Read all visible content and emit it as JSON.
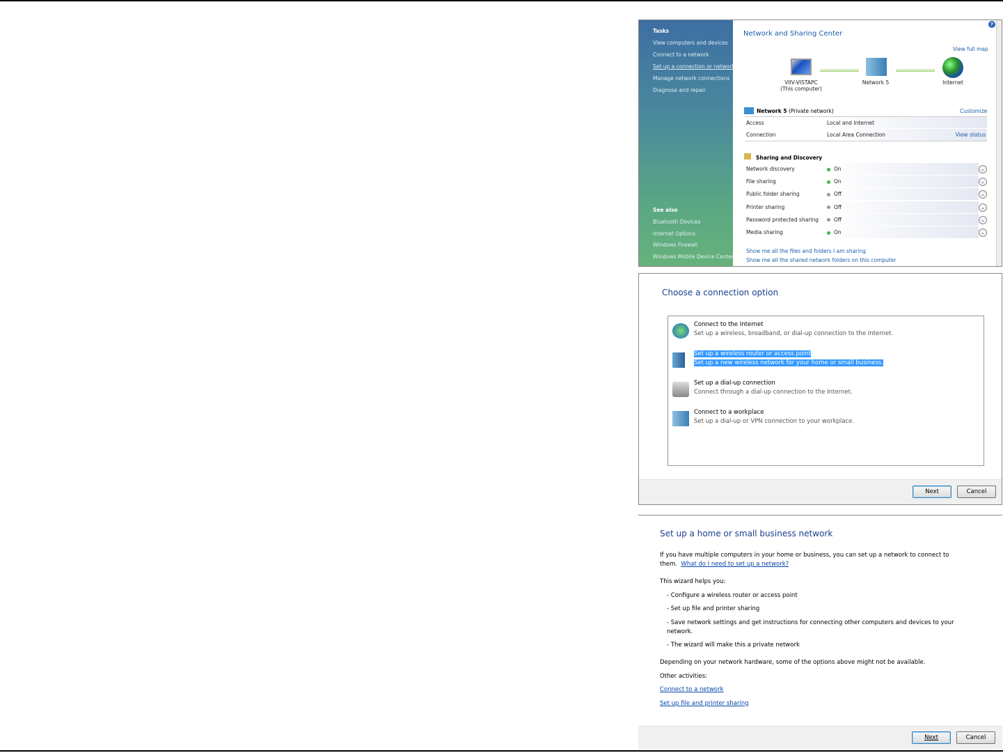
{
  "nsc": {
    "sidebar": {
      "tasks_heading": "Tasks",
      "tasks": [
        "View computers and devices",
        "Connect to a network",
        "Set up a connection or network",
        "Manage network connections",
        "Diagnose and repair"
      ],
      "see_also_heading": "See also",
      "see_also": [
        "Bluetooth Devices",
        "Internet Options",
        "Windows Firewall",
        "Windows Mobile Device Center"
      ]
    },
    "title": "Network and Sharing Center",
    "view_full_map": "View full map",
    "map": {
      "computer": "VIIV-VISTAPC",
      "computer_sub": "(This computer)",
      "network": "Network  5",
      "internet": "Internet"
    },
    "network_name": "Network  5",
    "network_type": "(Private network)",
    "customize": "Customize",
    "access_label": "Access",
    "access_value": "Local and Internet",
    "connection_label": "Connection",
    "connection_value": "Local Area Connection",
    "view_status": "View status",
    "sharing_heading": "Sharing and Discovery",
    "sharing": [
      {
        "label": "Network discovery",
        "state": "On"
      },
      {
        "label": "File sharing",
        "state": "On"
      },
      {
        "label": "Public folder sharing",
        "state": "Off"
      },
      {
        "label": "Printer sharing",
        "state": "Off"
      },
      {
        "label": "Password protected sharing",
        "state": "Off"
      },
      {
        "label": "Media sharing",
        "state": "On"
      }
    ],
    "links": [
      "Show me all the files and folders I am sharing",
      "Show me all the shared network folders on this computer"
    ],
    "colors": {
      "on": "#3cb83c",
      "off": "#999999"
    }
  },
  "choose": {
    "title": "Choose a connection option",
    "options": [
      {
        "title": "Connect to the Internet",
        "desc": "Set up a wireless, broadband, or dial-up connection to the Internet."
      },
      {
        "title": "Set up a wireless router or access point",
        "desc": "Set up a new wireless network for your home or small business."
      },
      {
        "title": "Set up a dial-up connection",
        "desc": "Connect through a dial-up connection to the Internet."
      },
      {
        "title": "Connect to a workplace",
        "desc": "Set up a dial-up or VPN connection to your workplace."
      }
    ],
    "next": "Next",
    "cancel": "Cancel"
  },
  "setup": {
    "title": "Set up a home or small business network",
    "intro": "If you have multiple computers in your home or business, you can set up a network to connect to",
    "intro2": "them.",
    "help_link": "What do I need to set up a network?",
    "helps": "This wizard helps you:",
    "bullets": [
      "- Configure a wireless router or access point",
      "- Set up file and printer sharing",
      "- Save network settings and get instructions for connecting other computers and devices to your",
      "- The wizard will make this a private network"
    ],
    "bullet3_cont": "network.",
    "depending": "Depending on your network hardware, some of the options above might not be available.",
    "other": "Other activities:",
    "other_links": [
      "Connect to a network",
      "Set up file and printer sharing"
    ],
    "next": "Next",
    "cancel": "Cancel"
  }
}
